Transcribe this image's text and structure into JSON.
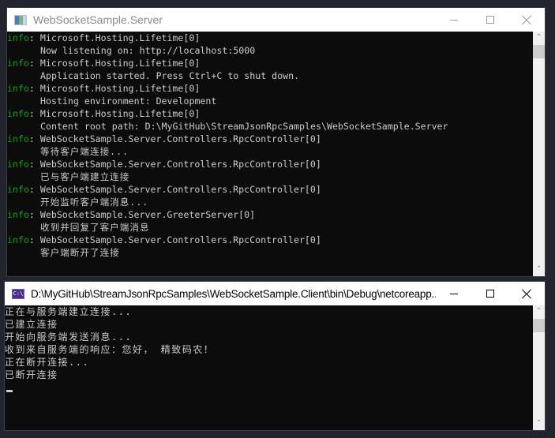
{
  "server_window": {
    "title": "WebSocketSample.Server",
    "icon": "console-app-icon",
    "controls": {
      "minimize": "minimize",
      "maximize": "maximize",
      "close": "close"
    },
    "log": [
      {
        "level": "info",
        "source": "Microsoft.Hosting.Lifetime[0]",
        "message": "Now listening on: http://localhost:5000"
      },
      {
        "level": "info",
        "source": "Microsoft.Hosting.Lifetime[0]",
        "message": "Application started. Press Ctrl+C to shut down."
      },
      {
        "level": "info",
        "source": "Microsoft.Hosting.Lifetime[0]",
        "message": "Hosting environment: Development"
      },
      {
        "level": "info",
        "source": "Microsoft.Hosting.Lifetime[0]",
        "message": "Content root path: D:\\MyGitHub\\StreamJsonRpcSamples\\WebSocketSample.Server"
      },
      {
        "level": "info",
        "source": "WebSocketSample.Server.Controllers.RpcController[0]",
        "message": "等待客户端连接..."
      },
      {
        "level": "info",
        "source": "WebSocketSample.Server.Controllers.RpcController[0]",
        "message": "已与客户端建立连接"
      },
      {
        "level": "info",
        "source": "WebSocketSample.Server.Controllers.RpcController[0]",
        "message": "开始监听客户端消息..."
      },
      {
        "level": "info",
        "source": "WebSocketSample.Server.GreeterServer[0]",
        "message": "收到并回复了客户端消息"
      },
      {
        "level": "info",
        "source": "WebSocketSample.Server.Controllers.RpcController[0]",
        "message": "客户端断开了连接"
      }
    ],
    "scrollbar": {
      "up": "▲",
      "down": "▼"
    }
  },
  "client_window": {
    "title": "D:\\MyGitHub\\StreamJsonRpcSamples\\WebSocketSample.Client\\bin\\Debug\\netcoreapp...",
    "icon_label": "C:\\",
    "controls": {
      "minimize": "minimize",
      "maximize": "maximize",
      "close": "close"
    },
    "lines": [
      "正在与服务端建立连接...",
      "已建立连接",
      "开始向服务端发送消息...",
      "收到来自服务端的响应：您好， 精致码农！",
      "正在断开连接...",
      "已断开连接"
    ],
    "scrollbar": {
      "up": "▲",
      "down": "▼"
    }
  },
  "colors": {
    "desktop": "#22242e",
    "console_bg": "#0c0c0c",
    "console_text": "#cccccc",
    "info_level": "#13a10e",
    "titlebar": "#ffffff"
  }
}
